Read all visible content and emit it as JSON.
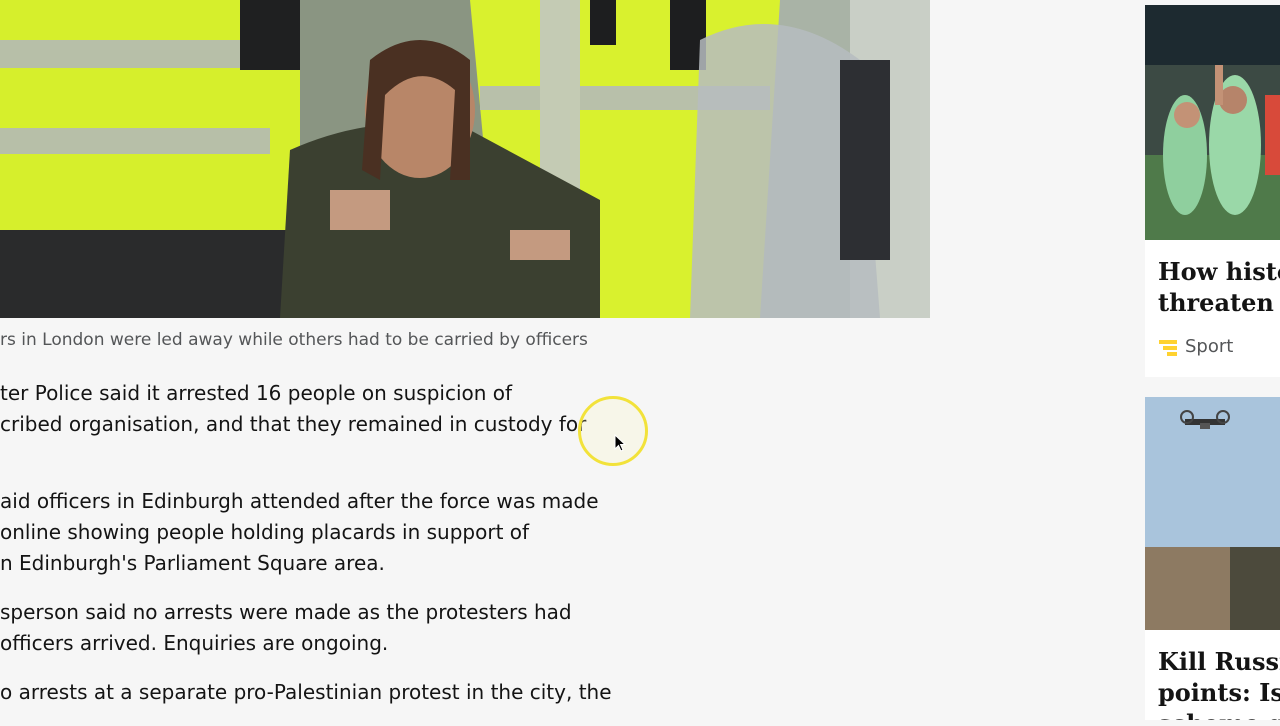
{
  "article": {
    "caption": "rs in London were led away while others had to be carried by officers",
    "paragraphs": [
      [
        "ter Police said it arrested 16 people on suspicion of",
        "cribed organisation, and that they remained in custody for"
      ],
      [
        "aid officers in Edinburgh attended after the force was made",
        "online showing people holding placards in support of",
        "n Edinburgh's Parliament Square area."
      ],
      [
        "sperson said no arrests were made as the protesters had",
        "officers arrived. Enquiries are ongoing."
      ],
      [
        "o arrests at a separate pro-Palestinian protest in the city, the"
      ]
    ]
  },
  "rail": {
    "cards": [
      {
        "title_lines": [
          "How histo",
          "threaten E"
        ],
        "tag": "Sport",
        "tag_icon": "sport-icon",
        "accent": "#ffd230"
      },
      {
        "title_lines": [
          "Kill Russia",
          "points: Is U",
          "scheme ga"
        ]
      }
    ]
  },
  "colors": {
    "background": "#f6f6f6",
    "hi_vis": "#d8f02a",
    "cursor_highlight": "#f2e23a"
  }
}
